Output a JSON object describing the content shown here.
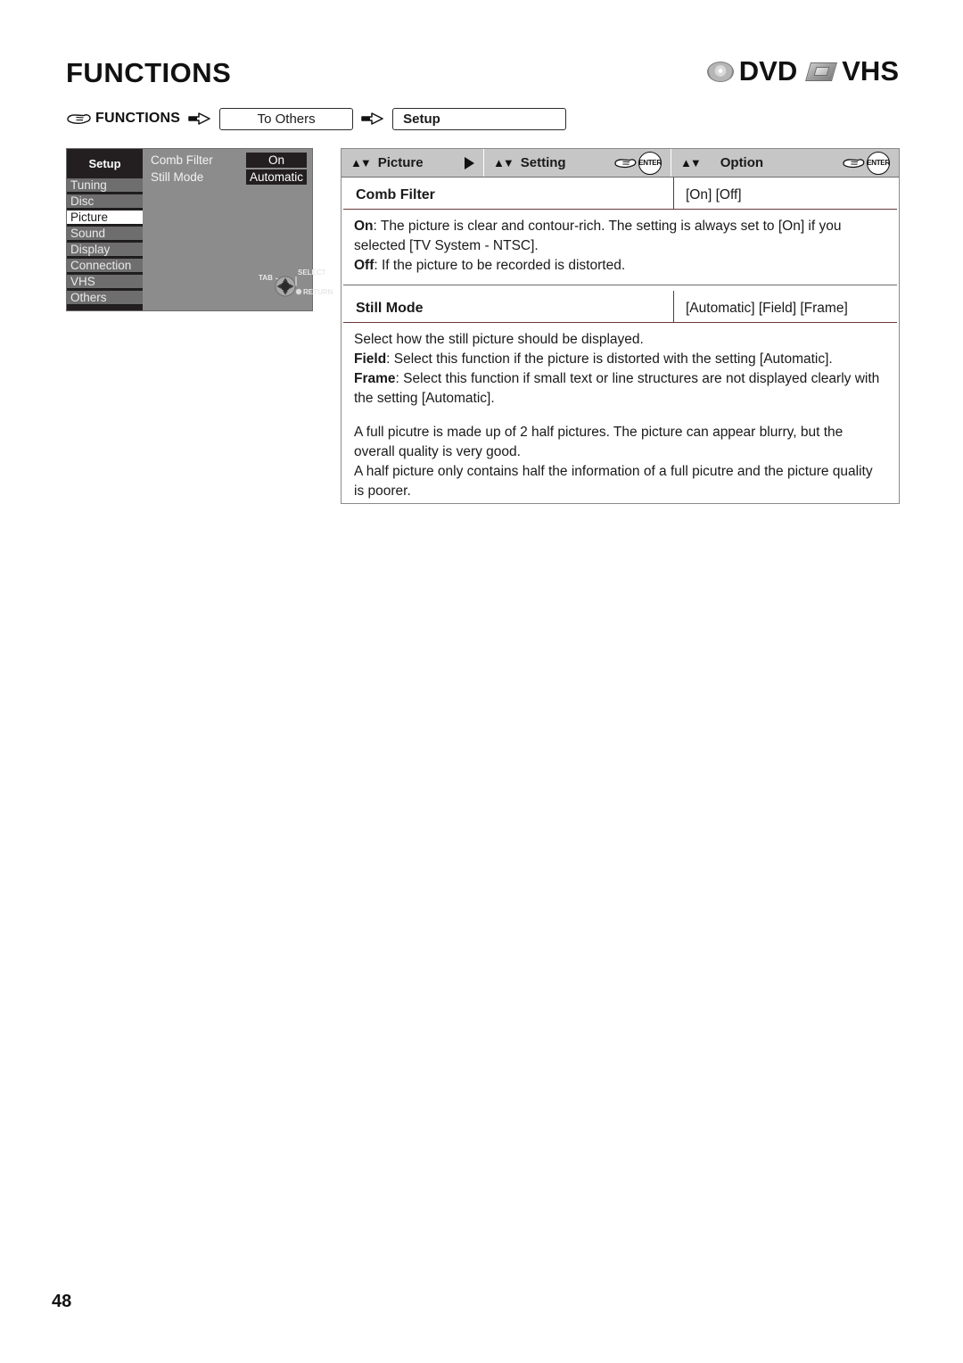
{
  "page": {
    "title": "FUNCTIONS",
    "number": "48"
  },
  "media_badges": [
    {
      "icon": "dvd-disc-icon",
      "label": "DVD"
    },
    {
      "icon": "vhs-cassette-icon",
      "label": "VHS"
    }
  ],
  "breadcrumb": {
    "hand_icon": "pointing-hand-icon",
    "root": "FUNCTIONS",
    "arrow_icon": "block-arrow-right-icon",
    "step1": "To Others",
    "step2": "Setup"
  },
  "osd": {
    "title": "Setup",
    "menu": [
      {
        "label": "Tuning",
        "selected": false
      },
      {
        "label": "Disc",
        "selected": false
      },
      {
        "label": "Picture",
        "selected": true
      },
      {
        "label": "Sound",
        "selected": false
      },
      {
        "label": "Display",
        "selected": false
      },
      {
        "label": "Connection",
        "selected": false
      },
      {
        "label": "VHS",
        "selected": false
      },
      {
        "label": "Others",
        "selected": false
      }
    ],
    "rows": [
      {
        "name": "Comb Filter",
        "value": "On"
      },
      {
        "name": "Still Mode",
        "value": "Automatic"
      }
    ],
    "dpad": {
      "tab": "TAB",
      "select": "SELECT",
      "return": "RETURN"
    },
    "colors": {
      "background": "#8c8c8c",
      "sidebar": "#231f20",
      "item": "#6e6e6e",
      "selected_item": "#ffffff"
    }
  },
  "panel": {
    "header": {
      "col1": {
        "arrows": "▲▼",
        "label": "Picture",
        "trailing_icon": "right-triangle-icon"
      },
      "col2": {
        "arrows": "▲▼",
        "label": "Setting",
        "trailing_icon": "hand-enter-icon",
        "enter": "ENTER"
      },
      "col3": {
        "arrows": "▲▼",
        "label": "Option",
        "trailing_icon": "hand-enter-icon",
        "enter": "ENTER"
      }
    },
    "entries": [
      {
        "name": "Comb Filter",
        "values": "[On] [Off]",
        "paragraphs": [
          {
            "bold": "On",
            "rest": ": The picture is clear and contour-rich. The setting is always set to [On] if you selected [TV System - NTSC].",
            "gap": false
          },
          {
            "bold": "Off",
            "rest": ": If the picture to be recorded is distorted.",
            "gap": false
          }
        ]
      },
      {
        "name": "Still Mode",
        "values": "[Automatic] [Field] [Frame]",
        "paragraphs": [
          {
            "bold": "",
            "rest": "Select how the still picture should be displayed.",
            "gap": false
          },
          {
            "bold": "Field",
            "rest": ": Select this function if the picture is distorted with the setting [Automatic].",
            "gap": false
          },
          {
            "bold": "Frame",
            "rest": ": Select this function if small text or line structures are not displayed clearly with the setting [Automatic].",
            "gap": false
          },
          {
            "bold": "",
            "rest": "A full picutre is made up of 2 half pictures. The picture can appear blurry, but the overall quality is very good.",
            "gap": true
          },
          {
            "bold": "",
            "rest": "A half picture only contains half the information of a full picutre and the picture quality is poorer.",
            "gap": false
          }
        ]
      }
    ]
  }
}
